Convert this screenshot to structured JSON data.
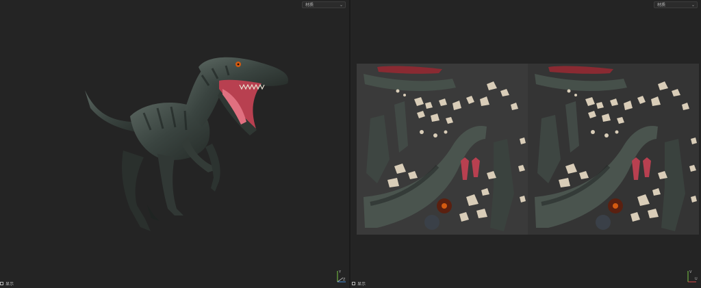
{
  "left_viewport": {
    "dropdown": {
      "value": "材质"
    },
    "footer": {
      "checkbox_label": "显示"
    },
    "axis": {
      "y": "Y",
      "z": "Z"
    }
  },
  "right_viewport": {
    "dropdown": {
      "value": "材质"
    },
    "footer": {
      "checkbox_label": "显示"
    },
    "axis": {
      "v": "V",
      "u": "U"
    }
  },
  "colors": {
    "background": "#242424",
    "uv_sheet": "#3a3a3a",
    "skin": "#3f4a44",
    "mouth": "#b84050",
    "eye": "#d45a10"
  }
}
